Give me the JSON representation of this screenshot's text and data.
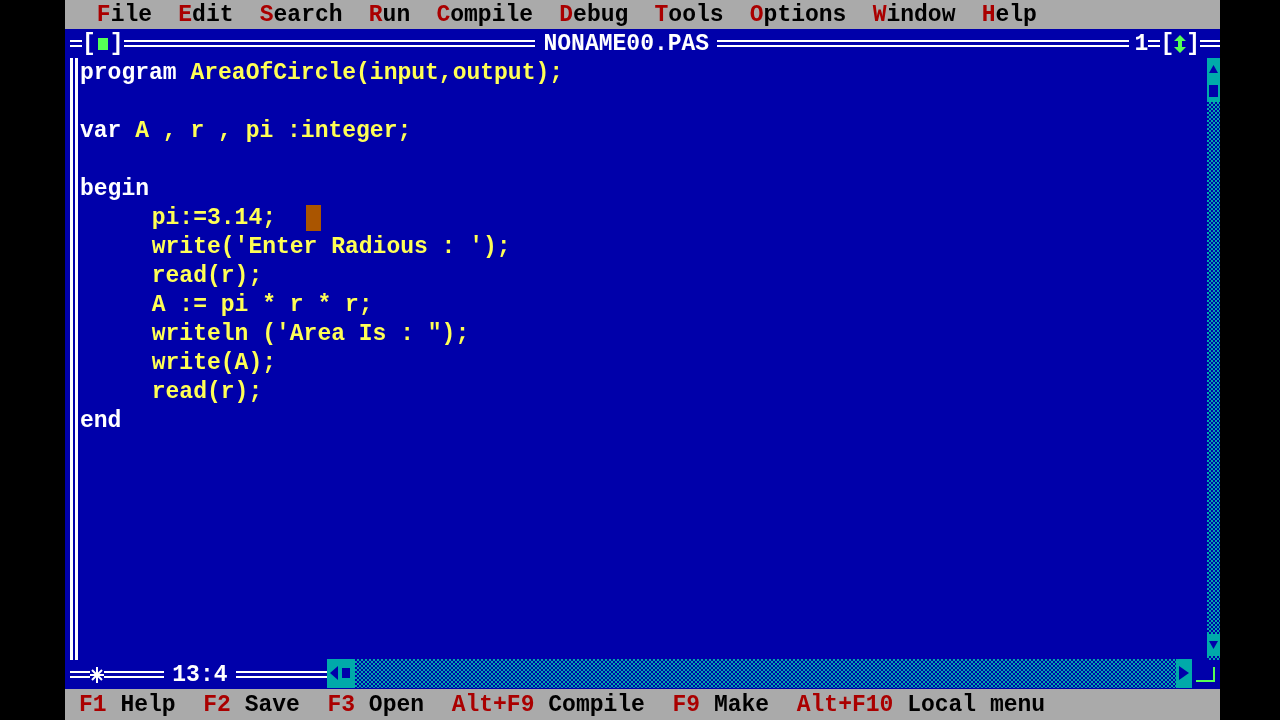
{
  "menu": [
    {
      "hotkey": "F",
      "label": "ile"
    },
    {
      "hotkey": "E",
      "label": "dit"
    },
    {
      "hotkey": "S",
      "label": "earch"
    },
    {
      "hotkey": "R",
      "label": "un"
    },
    {
      "hotkey": "C",
      "label": "ompile"
    },
    {
      "hotkey": "D",
      "label": "ebug"
    },
    {
      "hotkey": "T",
      "label": "ools"
    },
    {
      "hotkey": "O",
      "label": "ptions"
    },
    {
      "hotkey": "W",
      "label": "indow"
    },
    {
      "hotkey": "H",
      "label": "elp"
    }
  ],
  "editor": {
    "close_box": [
      "[",
      "]"
    ],
    "title": "NONAME00.PAS",
    "window_number": "1",
    "zoom_box": [
      "[",
      "]"
    ],
    "lines": [
      {
        "kind": "code",
        "indented": false,
        "cursor": false,
        "tokens": [
          {
            "kind": "keyword",
            "text": "program"
          },
          {
            "kind": "plain",
            "text": "AreaOfCircle(input,output);"
          }
        ]
      },
      {
        "kind": "blank"
      },
      {
        "kind": "code",
        "indented": false,
        "cursor": false,
        "tokens": [
          {
            "kind": "keyword",
            "text": "var"
          },
          {
            "kind": "plain",
            "text": "A , r , pi :integer;"
          }
        ]
      },
      {
        "kind": "blank"
      },
      {
        "kind": "code",
        "indented": false,
        "cursor": false,
        "tokens": [
          {
            "kind": "keyword",
            "text": "begin"
          }
        ]
      },
      {
        "kind": "code",
        "indented": true,
        "cursor": true,
        "tokens": [
          {
            "kind": "plain",
            "text": "pi:=3.14;"
          }
        ]
      },
      {
        "kind": "code",
        "indented": true,
        "cursor": false,
        "tokens": [
          {
            "kind": "plain",
            "text": "write('Enter Radious : ');"
          }
        ]
      },
      {
        "kind": "code",
        "indented": true,
        "cursor": false,
        "tokens": [
          {
            "kind": "plain",
            "text": "read(r);"
          }
        ]
      },
      {
        "kind": "code",
        "indented": true,
        "cursor": false,
        "tokens": [
          {
            "kind": "plain",
            "text": "A := pi * r * r;"
          }
        ]
      },
      {
        "kind": "code",
        "indented": true,
        "cursor": false,
        "tokens": [
          {
            "kind": "plain",
            "text": "writeln ('Area Is : \");"
          }
        ]
      },
      {
        "kind": "code",
        "indented": true,
        "cursor": false,
        "tokens": [
          {
            "kind": "plain",
            "text": "write(A);"
          }
        ]
      },
      {
        "kind": "code",
        "indented": true,
        "cursor": false,
        "tokens": [
          {
            "kind": "plain",
            "text": "read(r);"
          }
        ]
      },
      {
        "kind": "code",
        "indented": false,
        "cursor": false,
        "tokens": [
          {
            "kind": "keyword",
            "text": "end"
          }
        ]
      }
    ],
    "modified": true,
    "position": "13:4"
  },
  "status_bar": [
    {
      "key": "F1",
      "label": "Help"
    },
    {
      "key": "F2",
      "label": "Save"
    },
    {
      "key": "F3",
      "label": "Open"
    },
    {
      "key": "Alt+F9",
      "label": "Compile"
    },
    {
      "key": "F9",
      "label": "Make"
    },
    {
      "key": "Alt+F10",
      "label": "Local menu"
    }
  ]
}
